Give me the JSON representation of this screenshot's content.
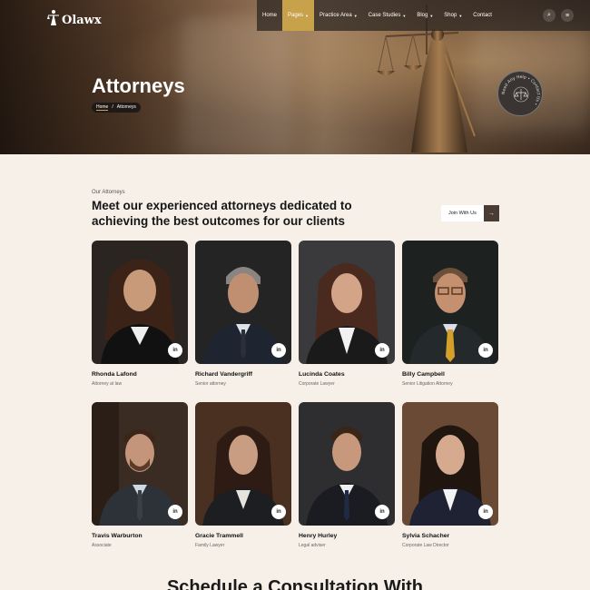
{
  "brand": {
    "name": "Olawx"
  },
  "nav": {
    "items": [
      {
        "label": "Home",
        "caret": false,
        "active": false
      },
      {
        "label": "Pages",
        "caret": true,
        "active": true
      },
      {
        "label": "Practice Area",
        "caret": true,
        "active": false
      },
      {
        "label": "Case Studies",
        "caret": true,
        "active": false
      },
      {
        "label": "Blog",
        "caret": true,
        "active": false
      },
      {
        "label": "Shop",
        "caret": true,
        "active": false
      },
      {
        "label": "Contact",
        "caret": false,
        "active": false
      }
    ],
    "search_icon": "search-icon",
    "menu_icon": "menu-icon"
  },
  "hero": {
    "title": "Attorneys",
    "breadcrumb": {
      "home": "Home",
      "separator": "/",
      "current": "Attorneys"
    },
    "badge_text": "Need Any Help • Contact Us • "
  },
  "section": {
    "eyebrow": "Our Attorneys",
    "heading": "Meet our experienced attorneys dedicated to achieving the best outcomes for our clients",
    "join_label": "Join With Us",
    "join_icon": "arrow-right-icon"
  },
  "attorneys": [
    {
      "name": "Rhonda Lafond",
      "role": "Attorney at law",
      "social": "in"
    },
    {
      "name": "Richard Vandergriff",
      "role": "Senior attorney",
      "social": "in"
    },
    {
      "name": "Lucinda Coates",
      "role": "Corporate Lawyer",
      "social": "in"
    },
    {
      "name": "Billy Campbell",
      "role": "Senior Litigation Attorney",
      "social": "in"
    },
    {
      "name": "Travis Warburton",
      "role": "Associate",
      "social": "in"
    },
    {
      "name": "Gracie Trammell",
      "role": "Family Lawyer",
      "social": "in"
    },
    {
      "name": "Henry Hurley",
      "role": "Legal adviser",
      "social": "in"
    },
    {
      "name": "Sylvia Schacher",
      "role": "Corporate Law Director",
      "social": "in"
    }
  ],
  "next_section": {
    "heading": "Schedule a Consultation With"
  },
  "colors": {
    "accent": "#c8a24a",
    "dark_button": "#4a3b35",
    "page_bg": "#f7f0e8"
  }
}
